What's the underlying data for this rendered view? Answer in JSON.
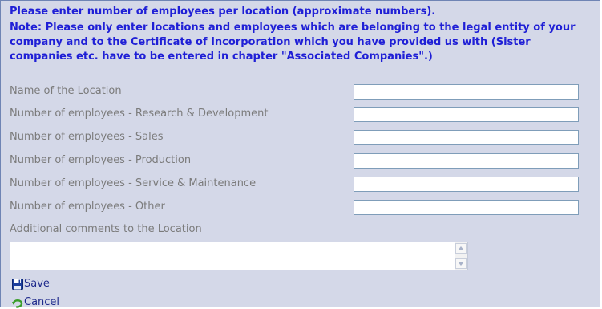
{
  "note": {
    "line1": "Please enter number of employees per location (approximate numbers).",
    "line2": "Note: Please only enter locations and employees which are belonging to the legal entity of your company and to the Certificate of Incorporation which you have provided us with (Sister companies etc. have to be entered in chapter \"Associated Companies\".)"
  },
  "fields": [
    {
      "label": "Name of the Location",
      "value": ""
    },
    {
      "label": "Number of employees - Research & Development",
      "value": ""
    },
    {
      "label": "Number of employees - Sales",
      "value": ""
    },
    {
      "label": "Number of employees - Production",
      "value": ""
    },
    {
      "label": "Number of employees - Service & Maintenance",
      "value": ""
    },
    {
      "label": "Number of employees - Other",
      "value": ""
    }
  ],
  "comments": {
    "label": "Additional comments to the Location",
    "value": ""
  },
  "actions": {
    "save_label": "Save",
    "save_icon": "floppy-disk-icon",
    "cancel_label": "Cancel",
    "cancel_icon": "undo-arrow-icon"
  },
  "colors": {
    "note_text": "#1f1fd6",
    "label_text": "#7b7b7b",
    "panel_background": "#d4d8e8",
    "panel_border": "#6f84b4",
    "action_link": "#1f2a8c"
  }
}
